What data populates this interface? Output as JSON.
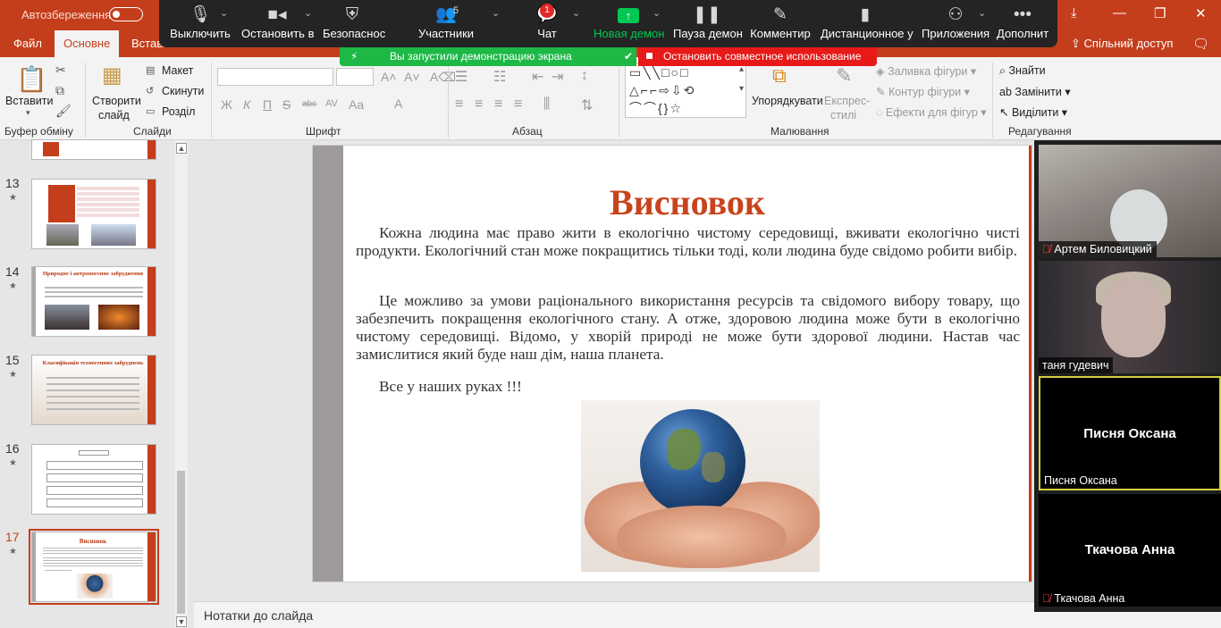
{
  "titlebar": {
    "autosave_label": "Автозбереження",
    "window_controls": [
      "⤓",
      "—",
      "❐",
      "✕"
    ],
    "share_label": "Спільний доступ"
  },
  "tabs": [
    "Файл",
    "Основне",
    "Вставл"
  ],
  "zoom_toolbar": {
    "buttons": [
      {
        "label": "Выключить",
        "icon": "microphone-icon"
      },
      {
        "label": "Остановить в",
        "icon": "video-camera-icon"
      },
      {
        "label": "Безопаснос",
        "icon": "shield-icon"
      },
      {
        "label": "Участники",
        "icon": "participants-icon",
        "count": "5"
      },
      {
        "label": "Чат",
        "icon": "chat-icon",
        "badge": "1"
      },
      {
        "label": "Новая демон",
        "icon": "new-share-icon"
      },
      {
        "label": "Пауза демон",
        "icon": "pause-icon"
      },
      {
        "label": "Комментир",
        "icon": "annotate-pencil-icon"
      },
      {
        "label": "Дистанционное у",
        "icon": "remote-control-mouse-icon"
      },
      {
        "label": "Приложения",
        "icon": "apps-icon"
      },
      {
        "label": "Дополнит",
        "icon": "more-dots-icon"
      }
    ],
    "sharing_banner": "Вы запустили демонстрацию экрана",
    "stop_share": "Остановить совместное использование"
  },
  "ribbon": {
    "paste": "Вставити",
    "new_slide": [
      "Створити",
      "слайд"
    ],
    "layout": "Макет",
    "reset": "Скинути",
    "section": "Розділ",
    "groups": [
      "Буфер обміну",
      "Слайди",
      "Шрифт",
      "Абзац",
      "Малювання",
      "Редагування"
    ],
    "arrange": "Упорядкувати",
    "quick_styles": [
      "Експрес-",
      "стилі"
    ],
    "shape_fill": "Заливка фігури",
    "shape_outline": "Контур фігури",
    "shape_effects": "Ефекти для фігур",
    "find": "Знайти",
    "replace": "Замінити",
    "select": "Виділити",
    "font_buttons": [
      "Ж",
      "К",
      "П",
      "S",
      "abc",
      "Aa"
    ]
  },
  "thumbnails": [
    {
      "num": "13",
      "title": ""
    },
    {
      "num": "14",
      "title": "Природне і антропогенне забруднення"
    },
    {
      "num": "15",
      "title": "Класифікація техногенних забруднень"
    },
    {
      "num": "16",
      "title": ""
    },
    {
      "num": "17",
      "title": "Висновок"
    }
  ],
  "slide": {
    "title": "Висновок",
    "p1": "Кожна людина має право жити в екологічно чистому середовищі, вживати екологічно чисті продукти. Екологічний стан може покращитись тільки тоді, коли людина буде свідомо робити вибір.",
    "p2": "Це можливо за умови раціонального використання ресурсів та свідомого вибору товару, що забезпечить покращення екологічного стану. А отже, здоровою людина може бути в екологічно чистому середовищі. Відомо, у хворій природі не може бути здорової людини. Настав час замислитися який буде наш дім, наша планета.",
    "p3": "Все у наших руках !!!"
  },
  "notes_label": "Нотатки до слайда",
  "participants": [
    {
      "name": "Артем Биловицкий",
      "muted": true,
      "video": true
    },
    {
      "name": "таня гудевич",
      "muted": false,
      "video": true
    },
    {
      "name": "Писня Оксана",
      "muted": false,
      "video": false,
      "active": true
    },
    {
      "name": "Ткачова Анна",
      "muted": true,
      "video": false
    }
  ]
}
